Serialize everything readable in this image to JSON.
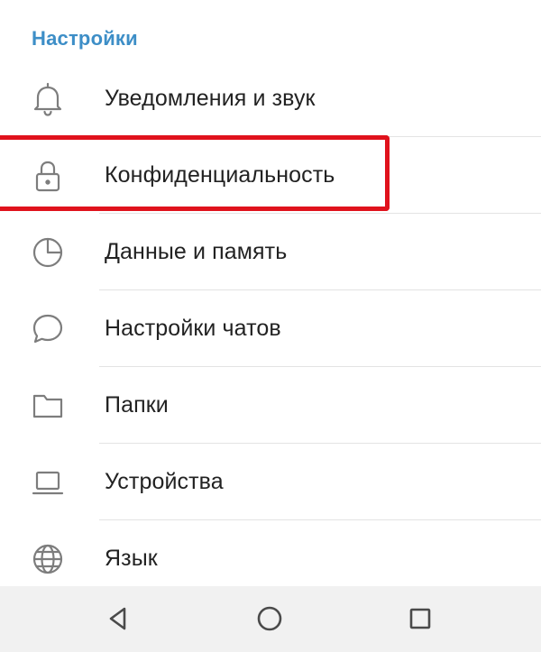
{
  "section": {
    "title": "Настройки"
  },
  "menu": {
    "items": [
      {
        "label": "Уведомления и звук",
        "icon": "bell-icon"
      },
      {
        "label": "Конфиденциальность",
        "icon": "lock-icon"
      },
      {
        "label": "Данные и память",
        "icon": "pie-chart-icon"
      },
      {
        "label": "Настройки чатов",
        "icon": "chat-bubble-icon"
      },
      {
        "label": "Папки",
        "icon": "folder-icon"
      },
      {
        "label": "Устройства",
        "icon": "laptop-icon"
      },
      {
        "label": "Язык",
        "icon": "globe-icon"
      }
    ]
  },
  "highlight": {
    "target": "Конфиденциальность",
    "color": "#e0121c"
  },
  "navbar": {
    "buttons": [
      "back-icon",
      "home-icon",
      "recents-icon"
    ]
  },
  "colors": {
    "accent": "#3d8ec7",
    "icon": "#7d7d7d",
    "text": "#222222",
    "navbar_bg": "#f1f1f1"
  }
}
